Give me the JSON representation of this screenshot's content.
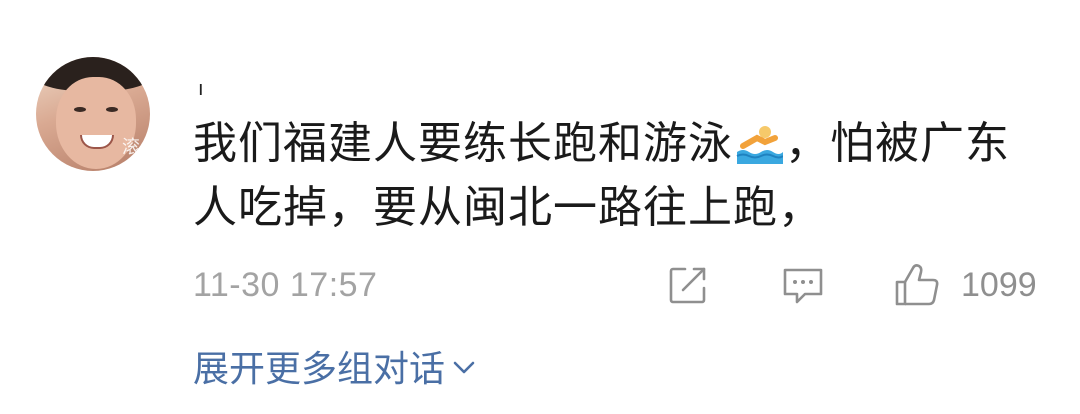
{
  "comment": {
    "username": "ı",
    "text_line1_before_emoji": "我们福建人要练长跑和游泳",
    "emoji": "swimmer-emoji",
    "text_line1_after_emoji": "，怕被广东",
    "text_line2": "人吃掉，要从闽北一路往上跑，",
    "timestamp": "11-30 17:57",
    "like_count": "1099",
    "avatar_watermark": "滚",
    "icons": {
      "share": "share-edit-icon",
      "reply": "comment-bubble-icon",
      "like": "thumbs-up-icon",
      "expand": "chevron-down-icon"
    }
  },
  "expand_link": {
    "label": "展开更多组对话"
  },
  "colors": {
    "text": "#1a1a1a",
    "meta": "#a3a3a3",
    "link": "#4a6fa5",
    "icon": "#8f8f8f"
  }
}
